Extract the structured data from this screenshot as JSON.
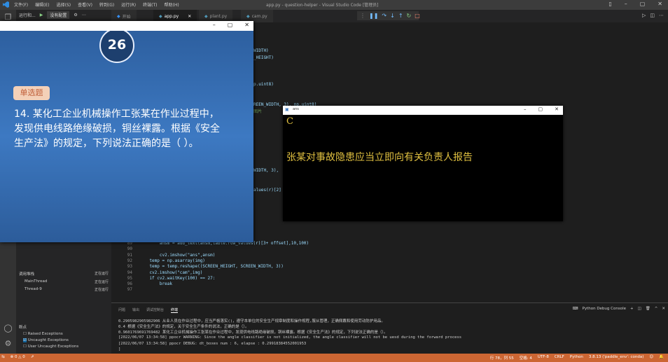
{
  "window": {
    "title": "app.py - question-helper - Visual Studio Code [管理员]",
    "menu": [
      "文件(F)",
      "编辑(E)",
      "选择(S)",
      "查看(V)",
      "转到(G)",
      "运行(R)",
      "终端(T)",
      "帮助(H)"
    ]
  },
  "run": {
    "label": "运行和...",
    "config": "没有配置"
  },
  "tabs": [
    {
      "label": "开始"
    },
    {
      "label": "app.py",
      "active": true
    },
    {
      "label": "plant.py"
    },
    {
      "label": "cam.py"
    }
  ],
  "code_fragments": {
    "f1": "WIDTH)",
    "f2": "_HEIGHT)",
    "f3": "p.uint8)",
    "f4": "REEN_WIDTH, 3), np.uint8)",
    "f5": "图片",
    "f6": "WIDTH, 3),",
    "f7": "alues(r)[2]"
  },
  "code_lines": [
    {
      "n": "89",
      "text": "        ansm = add_text(ansm,table.row_values(r)[3+ offset],10,100)"
    },
    {
      "n": "90",
      "text": ""
    },
    {
      "n": "91",
      "text": "        cv2.imshow(\"ans\",ansm)"
    },
    {
      "n": "92",
      "text": "    temp = np.asarray(img)"
    },
    {
      "n": "93",
      "text": "    temp = temp.reshape((SCREEN_HEIGHT, SCREEN_WIDTH, 3))"
    },
    {
      "n": "94",
      "text": "    cv2.imshow(\"cam\",img)"
    },
    {
      "n": "95",
      "text": "    if cv2.waitKey(100) == 27:"
    },
    {
      "n": "96",
      "text": "        break"
    },
    {
      "n": "97",
      "text": ""
    }
  ],
  "panel": {
    "tabs": [
      "问题",
      "输出",
      "调试控制台",
      "终端"
    ],
    "active_tab": "终端",
    "console_label": "Python Debug Console",
    "lines": [
      "0.2905982905982906 从业人员在作业过程中，应当严格落实()，遵守本单位的安全生产规章制度和操作规程,服从管理，正确佩戴和使用劳动防护用品。",
      "0.4 根据《安全生产法》的规定，关于安全生产条件的说法，正确的是（）。",
      "0.9601769691769482 某化工企业机械操作工张某在作业过程中，发现供电线路绝缘破损，铜丝裸露。根据《安全生产法》的规定，下列说法正确的是（）。",
      "[2022/06/07 13:34:58] ppocr WARNING: Since the angle classifier is not initialized, the angle classifier will not be uesd during the forward process",
      "[2022/06/07 13:34:58] ppocr DEBUG: dt_boxes num : 6, elapse : 0.29918384552001953",
      "]"
    ]
  },
  "sidebar": {
    "callstack_title": "调用堆栈",
    "callstack_status": "正在运行",
    "threads": [
      {
        "name": "MainThread",
        "status": "正在运行"
      },
      {
        "name": "Thread-9",
        "status": "正在运行"
      }
    ],
    "breakpoints_title": "断点",
    "breakpoints": [
      {
        "label": "Raised Exceptions",
        "checked": false
      },
      {
        "label": "Uncaught Exceptions",
        "checked": true
      },
      {
        "label": "User Uncaught Exceptions",
        "checked": false
      }
    ]
  },
  "status": {
    "errors": "0",
    "warnings": "0",
    "position": "行 78，列 55",
    "spaces": "空格: 4",
    "encoding": "UTF-8",
    "eol": "CRLF",
    "language": "Python",
    "interpreter": "3.8.13 ('paddle_env': conda)",
    "bg_color": "#cc6633"
  },
  "question_window": {
    "timer": "26",
    "badge": "单选题",
    "question": "14. 某化工企业机械操作工张某在作业过程中，发现供电线路绝缘破损，铜丝裸露。根据《安全生产法》的规定，下列说法正确的是（ ）。"
  },
  "ans_window": {
    "title": "ans",
    "choice": "C",
    "answer": "张某对事故隐患应当立即向有关负责人报告"
  }
}
